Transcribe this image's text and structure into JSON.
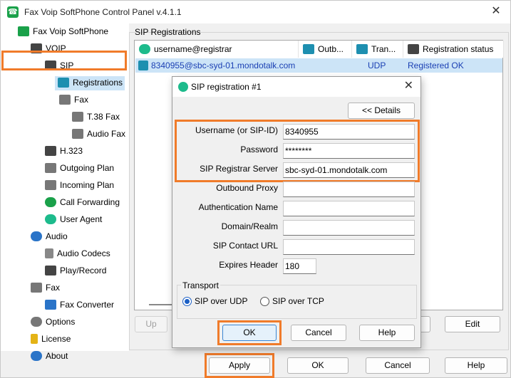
{
  "window": {
    "title": "Fax Voip SoftPhone Control Panel v.4.1.1",
    "close_glyph": "✕"
  },
  "tree": {
    "root": "Fax Voip SoftPhone",
    "voip": "VOIP",
    "sip": "SIP",
    "registrations": "Registrations",
    "fax": "Fax",
    "t38": "T.38 Fax",
    "audio_fax": "Audio Fax",
    "h323": "H.323",
    "outgoing": "Outgoing Plan",
    "incoming": "Incoming Plan",
    "forwarding": "Call Forwarding",
    "user_agent": "User Agent",
    "audio": "Audio",
    "codecs": "Audio Codecs",
    "play_record": "Play/Record",
    "fax2": "Fax",
    "converter": "Fax Converter",
    "options": "Options",
    "license": "License",
    "about": "About"
  },
  "registrations": {
    "group_label": "SIP Registrations",
    "columns": [
      "username@registrar",
      "Outb...",
      "Tran...",
      "Registration status"
    ],
    "rows": [
      {
        "user": "8340955@sbc-syd-01.mondotalk.com",
        "outbound": "",
        "transport": "UDP",
        "status": "Registered OK"
      }
    ],
    "buttons": {
      "up": "Up",
      "edit": "Edit"
    }
  },
  "dialog": {
    "title": "SIP registration #1",
    "details_button": "<< Details",
    "fields": {
      "username": {
        "label": "Username (or SIP-ID)",
        "value": "8340955"
      },
      "password": {
        "label": "Password",
        "value": "********"
      },
      "registrar": {
        "label": "SIP Registrar Server",
        "value": "sbc-syd-01.mondotalk.com"
      },
      "outbound_proxy": {
        "label": "Outbound Proxy",
        "value": ""
      },
      "auth_name": {
        "label": "Authentication Name",
        "value": ""
      },
      "domain": {
        "label": "Domain/Realm",
        "value": ""
      },
      "contact": {
        "label": "SIP Contact URL",
        "value": ""
      },
      "expires": {
        "label": "Expires Header",
        "value": "180"
      }
    },
    "transport": {
      "label": "Transport",
      "udp": "SIP over UDP",
      "tcp": "SIP over TCP",
      "selected": "udp"
    },
    "buttons": {
      "ok": "OK",
      "cancel": "Cancel",
      "help": "Help"
    }
  },
  "footer": {
    "apply": "Apply",
    "ok": "OK",
    "cancel": "Cancel",
    "help": "Help"
  },
  "colors": {
    "highlight": "#f07b2a",
    "selection": "#cce4f7",
    "link_text": "#1a3fb3"
  }
}
